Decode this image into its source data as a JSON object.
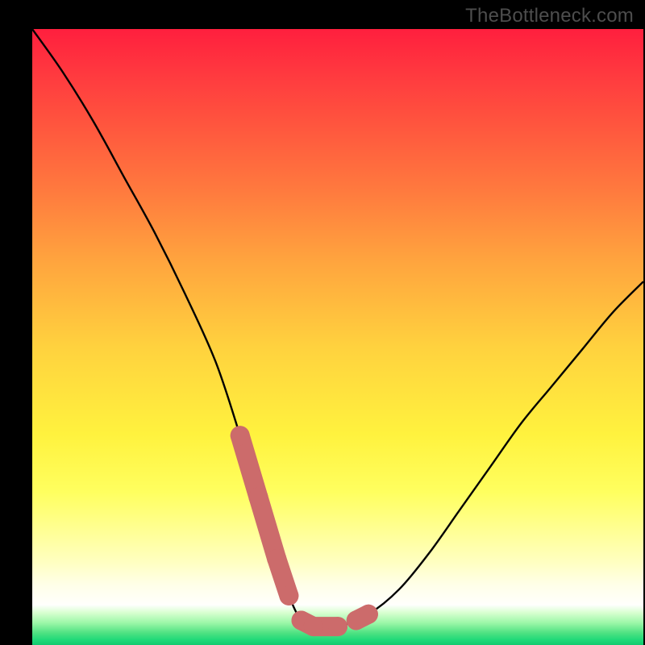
{
  "watermark": "TheBottleneck.com",
  "colors": {
    "background": "#000000",
    "curve": "#000000",
    "marker": "#cc6b6b",
    "gradient_top": "#ff1f3e",
    "gradient_mid": "#ffe23e",
    "gradient_bottom": "#12c96f"
  },
  "chart_data": {
    "type": "line",
    "title": "",
    "xlabel": "",
    "ylabel": "",
    "xlim": [
      0,
      100
    ],
    "ylim": [
      0,
      100
    ],
    "series": [
      {
        "name": "bottleneck-curve",
        "x": [
          0,
          5,
          10,
          15,
          20,
          25,
          30,
          34,
          37,
          40,
          42,
          44,
          46,
          50,
          55,
          60,
          65,
          70,
          75,
          80,
          85,
          90,
          95,
          100
        ],
        "values": [
          100,
          93,
          85,
          76,
          67,
          57,
          46,
          34,
          24,
          14,
          8,
          4,
          3,
          3,
          5,
          9,
          15,
          22,
          29,
          36,
          42,
          48,
          54,
          59
        ]
      }
    ],
    "markers": {
      "name": "highlighted-range",
      "x": [
        34,
        37,
        40,
        42,
        44,
        46,
        50,
        53,
        55
      ],
      "values": [
        34,
        24,
        14,
        8,
        4,
        3,
        3,
        4,
        5
      ]
    },
    "background_gradient": {
      "0": "#ff1f3e",
      "50": "#ffd23e",
      "80": "#ffff8f",
      "96": "#ffffff",
      "100": "#12c96f"
    }
  }
}
